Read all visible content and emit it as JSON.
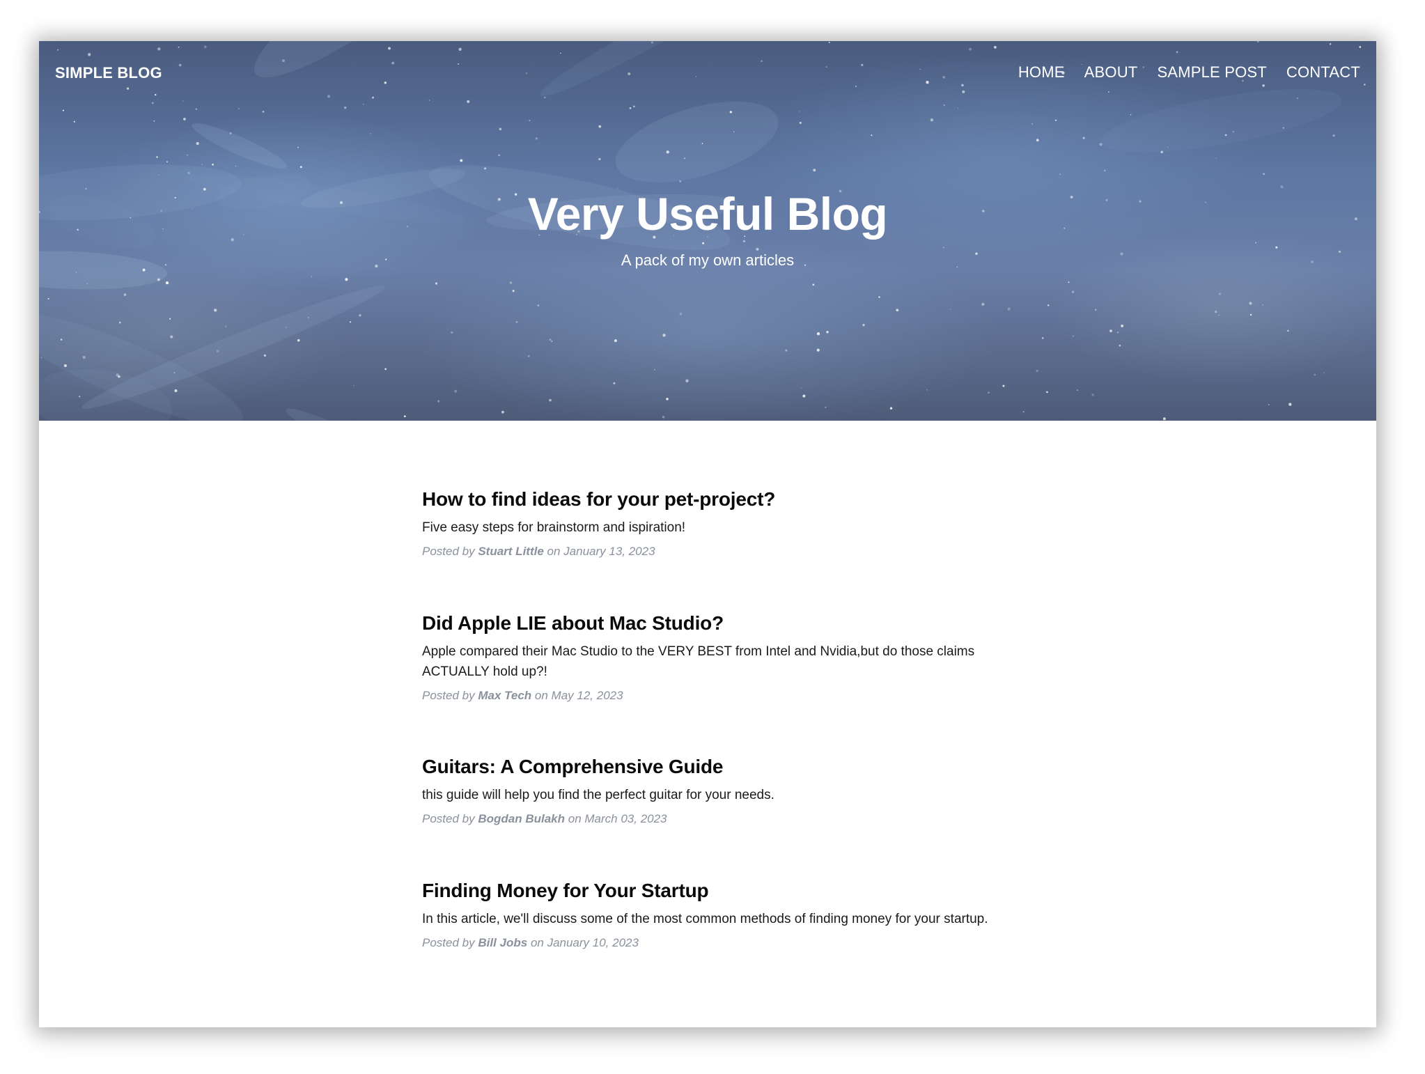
{
  "navbar": {
    "brand": "SIMPLE BLOG",
    "links": [
      "HOME",
      "ABOUT",
      "SAMPLE POST",
      "CONTACT"
    ]
  },
  "hero": {
    "title": "Very Useful Blog",
    "subtitle": "A pack of my own articles"
  },
  "posts": [
    {
      "title": "How to find ideas for your pet-project?",
      "subtitle": "Five easy steps for brainstorm and ispiration!",
      "posted_by": "Posted by",
      "author": "Stuart Little",
      "date": "on January 13, 2023"
    },
    {
      "title": "Did Apple LIE about Mac Studio?",
      "subtitle": "Apple compared their Mac Studio to the VERY BEST from Intel and Nvidia,but do those claims ACTUALLY hold up?!",
      "posted_by": "Posted by",
      "author": "Max Tech",
      "date": "on May 12, 2023"
    },
    {
      "title": "Guitars: A Comprehensive Guide",
      "subtitle": "this guide will help you find the perfect guitar for your needs.",
      "posted_by": "Posted by",
      "author": "Bogdan Bulakh",
      "date": "on March 03, 2023"
    },
    {
      "title": "Finding Money for Your Startup",
      "subtitle": "In this article, we'll discuss some of the most common methods of finding money for your startup.",
      "posted_by": "Posted by",
      "author": "Bill Jobs",
      "date": "on January 10, 2023"
    }
  ]
}
